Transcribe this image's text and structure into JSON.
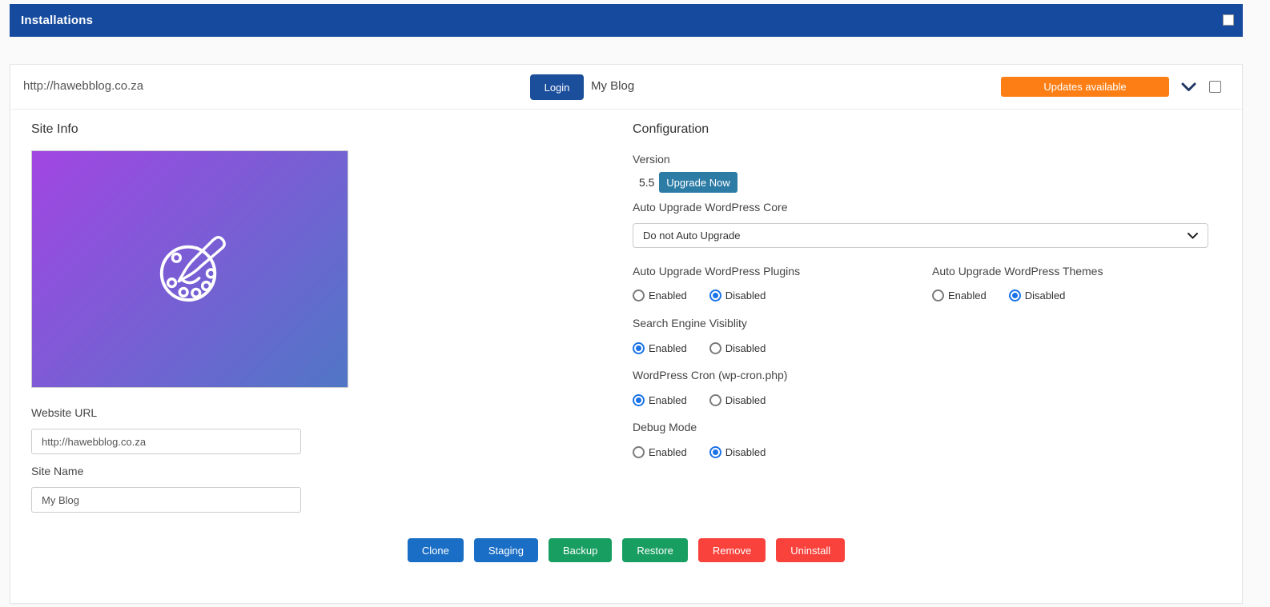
{
  "header": {
    "title": "Installations"
  },
  "install": {
    "url": "http://hawebblog.co.za",
    "login_label": "Login",
    "site_name": "My Blog",
    "updates_label": "Updates available"
  },
  "site_info": {
    "heading": "Site Info",
    "screenshot_icon": "palette-icon",
    "website_url_label": "Website URL",
    "website_url_value": "http://hawebblog.co.za",
    "site_name_label": "Site Name",
    "site_name_value": "My Blog"
  },
  "configuration": {
    "heading": "Configuration",
    "version_label": "Version",
    "version_value": "5.5",
    "upgrade_label": "Upgrade Now",
    "auto_upgrade_core": {
      "label": "Auto Upgrade WordPress Core",
      "selected": "Do not Auto Upgrade"
    },
    "radio_groups": [
      {
        "label": "Auto Upgrade WordPress Plugins",
        "options": [
          "Enabled",
          "Disabled"
        ],
        "selected": "Disabled"
      },
      {
        "label": "Auto Upgrade WordPress Themes",
        "options": [
          "Enabled",
          "Disabled"
        ],
        "selected": "Disabled"
      },
      {
        "label": "Search Engine Visiblity",
        "options": [
          "Enabled",
          "Disabled"
        ],
        "selected": "Enabled"
      },
      {
        "label": "WordPress Cron (wp-cron.php)",
        "options": [
          "Enabled",
          "Disabled"
        ],
        "selected": "Enabled"
      },
      {
        "label": "Debug Mode",
        "options": [
          "Enabled",
          "Disabled"
        ],
        "selected": "Disabled"
      }
    ]
  },
  "actions": [
    {
      "label": "Clone",
      "color": "#1a6ec5"
    },
    {
      "label": "Staging",
      "color": "#1a6ec5"
    },
    {
      "label": "Backup",
      "color": "#189e61"
    },
    {
      "label": "Restore",
      "color": "#189e61"
    },
    {
      "label": "Remove",
      "color": "#f8423b"
    },
    {
      "label": "Uninstall",
      "color": "#f8423b"
    }
  ],
  "colors": {
    "header_bar": "#164a9e",
    "login_button": "#1b4f9c",
    "updates_button": "#fd7e14",
    "upgrade_button": "#2d7ca6",
    "radio_accent": "#1a73e8",
    "screenshot_gradient_start": "#a246e3",
    "screenshot_gradient_end": "#5076c6"
  }
}
